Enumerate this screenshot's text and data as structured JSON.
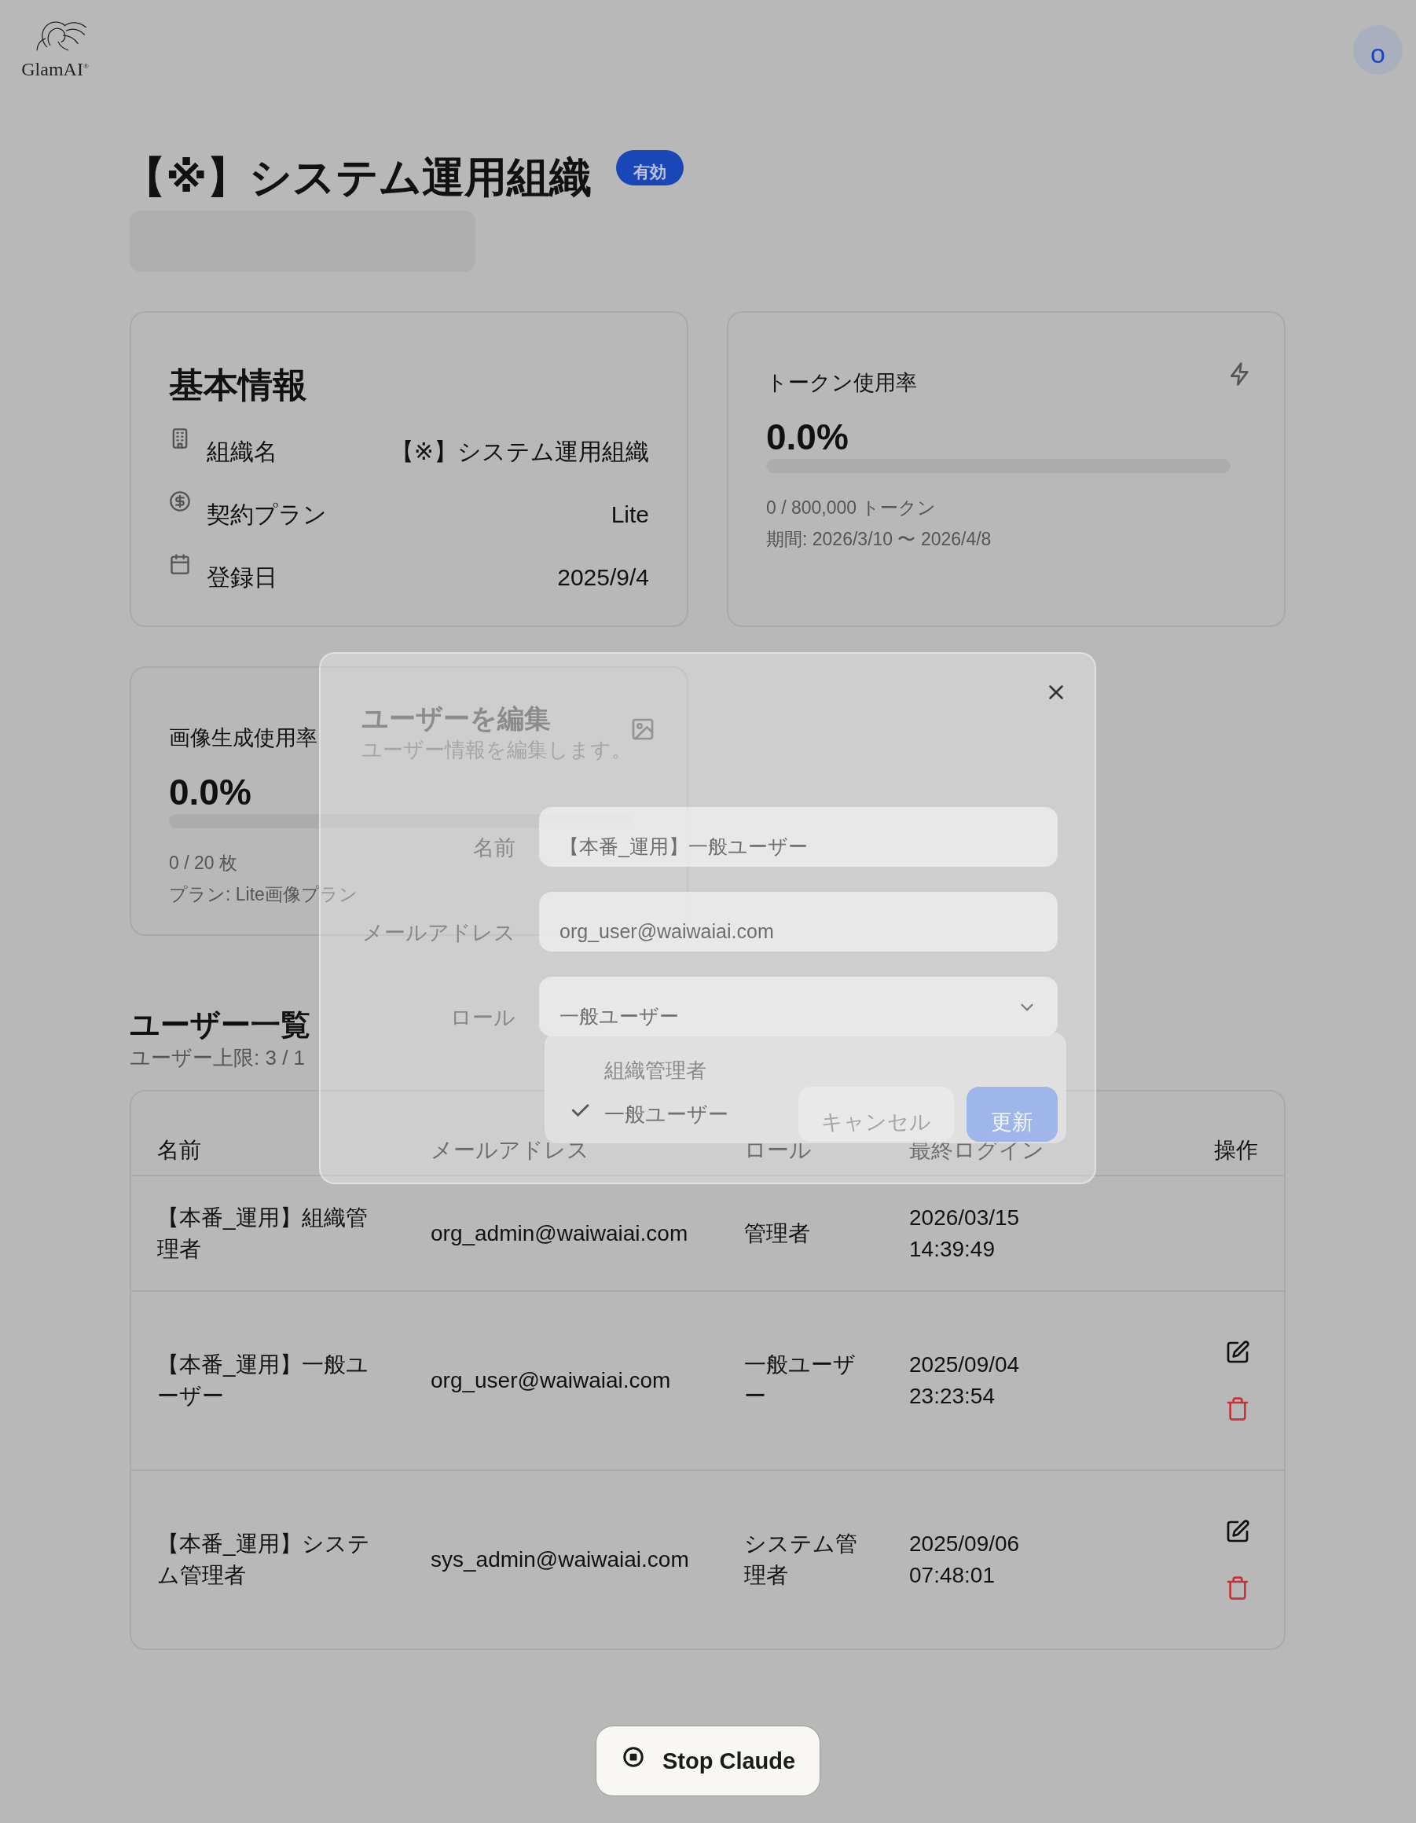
{
  "logo": {
    "text": "GlamAI",
    "mark": "®"
  },
  "avatar": {
    "initial": "o"
  },
  "organization": {
    "title": "【※】システム運用組織",
    "status": "有効",
    "active": true
  },
  "basic_info": {
    "title": "基本情報",
    "rows": [
      {
        "kind": "building",
        "label": "組織名",
        "value": "【※】システム運用組織"
      },
      {
        "kind": "dollar",
        "label": "契約プラン",
        "value": "Lite"
      },
      {
        "kind": "calendar",
        "label": "登録日",
        "value": "2025/9/4"
      }
    ]
  },
  "token_usage": {
    "title": "トークン使用率",
    "percent": "0.0%",
    "level": 0,
    "count": "0 / 800,000 トークン",
    "period": "期間: 2026/3/10 〜 2026/4/8"
  },
  "image_usage": {
    "title": "画像生成使用率",
    "percent": "0.0%",
    "level": 0,
    "count": "0 / 20 枚",
    "plan": "プラン: Lite画像プラン"
  },
  "users": {
    "title": "ユーザー一覧",
    "limit": "ユーザー上限: 3 / 1",
    "columns": [
      "名前",
      "メールアドレス",
      "ロール",
      "最終ログイン",
      "操作"
    ],
    "rows": [
      {
        "name": "【本番_運用】組織管理者",
        "email": "org_admin@waiwaiai.com",
        "role": "管理者",
        "last_login": "2026/03/15 14:39:49",
        "editable": false
      },
      {
        "name": "【本番_運用】一般ユーザー",
        "email": "org_user@waiwaiai.com",
        "role": "一般ユーザー",
        "last_login": "2025/09/04 23:23:54",
        "editable": true
      },
      {
        "name": "【本番_運用】システム管理者",
        "email": "sys_admin@waiwaiai.com",
        "role": "システム管理者",
        "last_login": "2025/09/06 07:48:01",
        "editable": true
      }
    ]
  },
  "edit_dialog": {
    "title": "ユーザーを編集",
    "subtitle": "ユーザー情報を編集します。",
    "fields": [
      {
        "kind": "text",
        "label": "名前",
        "value": "【本番_運用】一般ユーザー"
      },
      {
        "kind": "text",
        "label": "メールアドレス",
        "value": "org_user@waiwaiai.com"
      },
      {
        "kind": "select",
        "label": "ロール",
        "value": "一般ユーザー",
        "expanded": true,
        "options": [
          {
            "label": "組織管理者",
            "selected": false
          },
          {
            "label": "一般ユーザー",
            "selected": true
          }
        ]
      }
    ],
    "buttons": [
      {
        "kind": "secondary",
        "label": "キャンセル"
      },
      {
        "kind": "primary",
        "label": "更新"
      }
    ]
  },
  "stop_button": {
    "label": "Stop Claude"
  }
}
